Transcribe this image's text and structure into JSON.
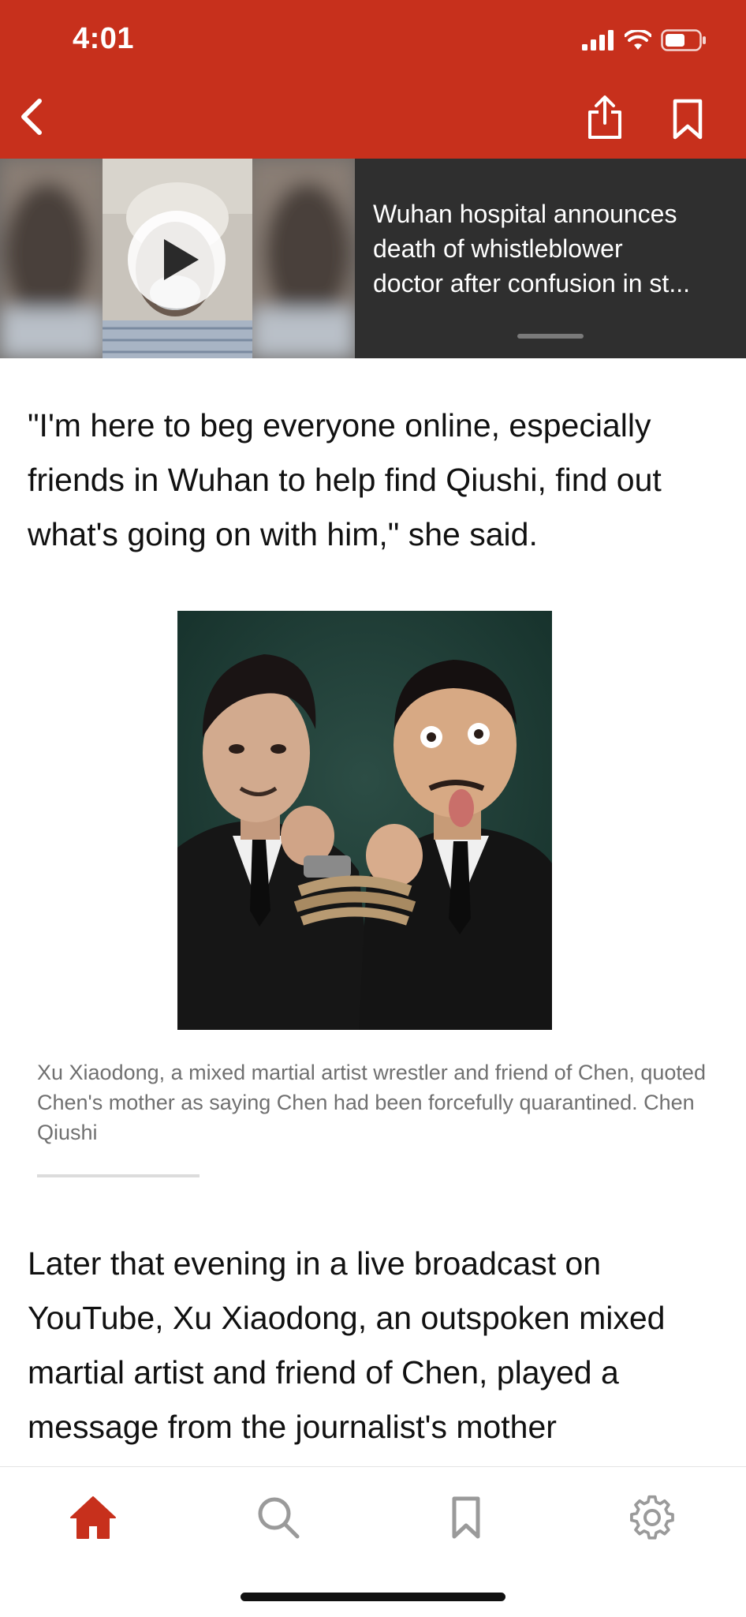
{
  "status_bar": {
    "time": "4:01",
    "icons": [
      "cellular-signal-icon",
      "wifi-icon",
      "battery-icon"
    ]
  },
  "nav": {
    "back_icon": "chevron-left-icon",
    "share_icon": "share-icon",
    "bookmark_icon": "bookmark-icon",
    "background_color": "#c7301c"
  },
  "video_banner": {
    "title_lines": [
      "Wuhan hospital announces",
      "death of whistleblower",
      "doctor after confusion in st..."
    ],
    "play_icon": "play-icon"
  },
  "article": {
    "paragraph_1": "\"I'm here to beg everyone online, especially friends in Wuhan to help find Qiushi, find out what's going on with him,\" she said.",
    "image_caption": "Xu Xiaodong, a mixed martial artist wrestler and friend of Chen, quoted Chen's mother as saying Chen had been forcefully quarantined. Chen Qiushi",
    "paragraph_2": "Later that evening in a live broadcast on YouTube, Xu Xiaodong, an outspoken mixed martial artist and friend of Chen, played a message from the journalist's mother"
  },
  "tab_bar": {
    "tabs": [
      {
        "icon": "home-icon",
        "active": true
      },
      {
        "icon": "search-icon",
        "active": false
      },
      {
        "icon": "bookmark-icon",
        "active": false
      },
      {
        "icon": "gear-icon",
        "active": false
      }
    ],
    "active_color": "#c7301c",
    "inactive_color": "#9a9a9a"
  }
}
